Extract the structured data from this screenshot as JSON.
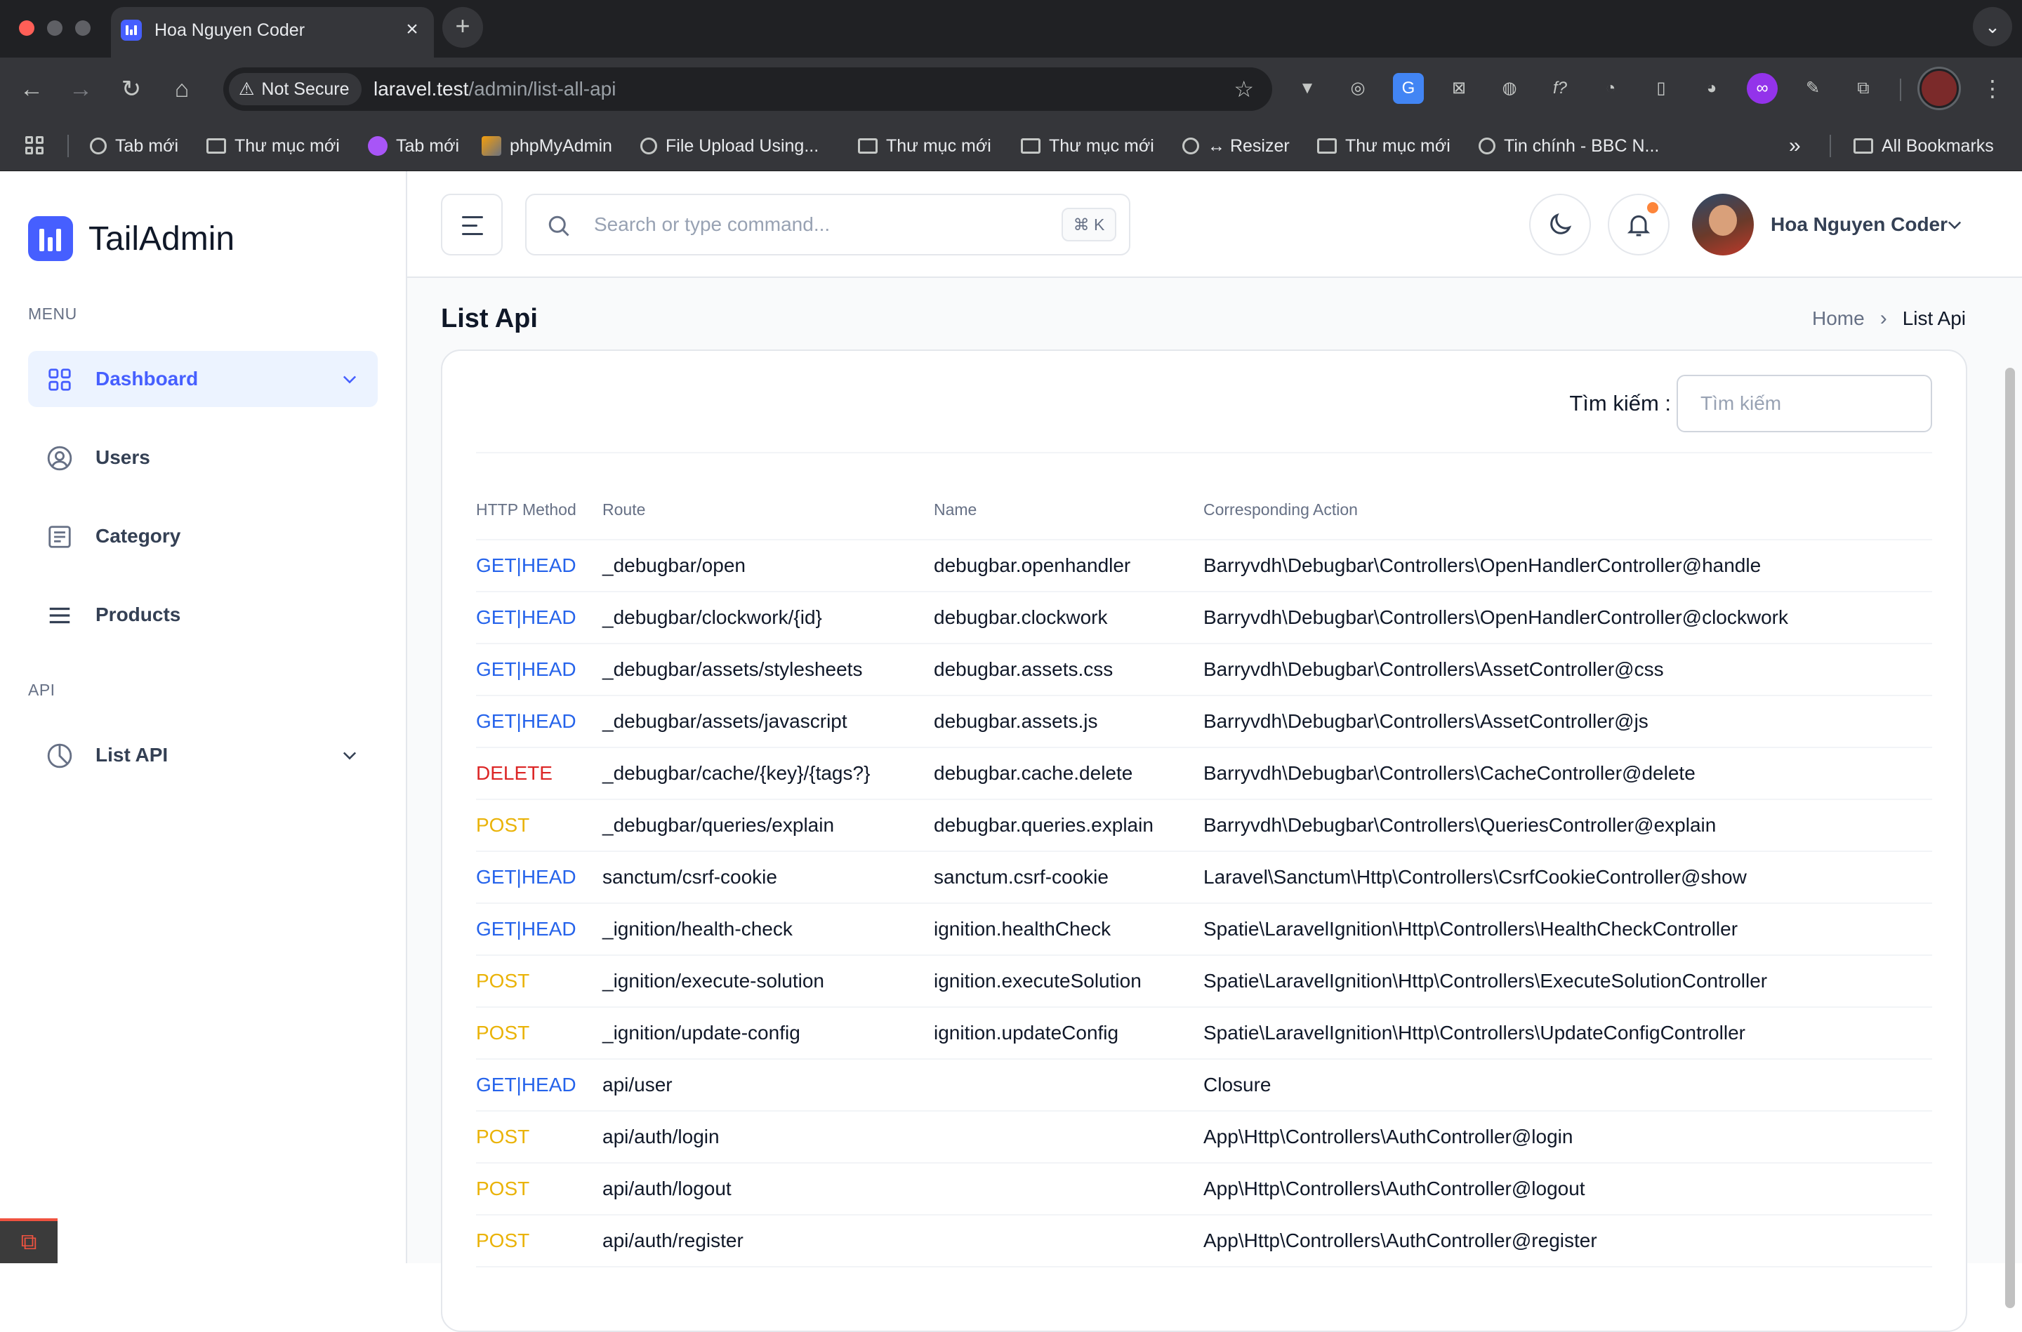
{
  "browser": {
    "tab_title": "Hoa Nguyen Coder",
    "security_label": "Not Secure",
    "url_host": "laravel.test",
    "url_path": "/admin/list-all-api",
    "bookmarks": [
      {
        "label": "Tab mới",
        "icon": "globe"
      },
      {
        "label": "Thư mục mới",
        "icon": "folder"
      },
      {
        "label": "Tab mới",
        "icon": "purple-app"
      },
      {
        "label": "phpMyAdmin",
        "icon": "phpmyadmin"
      },
      {
        "label": "File Upload Using...",
        "icon": "globe"
      },
      {
        "label": "Thư mục mới",
        "icon": "folder"
      },
      {
        "label": "Thư mục mới",
        "icon": "folder"
      },
      {
        "label": "↔ Resizer",
        "icon": "globe"
      },
      {
        "label": "Thư mục mới",
        "icon": "folder"
      },
      {
        "label": "Tin chính - BBC N...",
        "icon": "globe"
      }
    ],
    "more_bookmarks": "»",
    "all_bookmarks": "All Bookmarks"
  },
  "sidebar": {
    "brand": "TailAdmin",
    "group_menu": "MENU",
    "group_api": "API",
    "items": [
      {
        "label": "Dashboard",
        "icon": "grid-icon",
        "active": true
      },
      {
        "label": "Users",
        "icon": "user-circle-icon"
      },
      {
        "label": "Category",
        "icon": "list-box-icon"
      },
      {
        "label": "Products",
        "icon": "menu-lines-icon"
      },
      {
        "label": "List API",
        "icon": "pie-chart-icon"
      }
    ]
  },
  "header": {
    "search_placeholder": "Search or type command...",
    "shortcut": "⌘ K",
    "user_name": "Hoa Nguyen Coder"
  },
  "page": {
    "title": "List Api",
    "breadcrumb_home": "Home",
    "breadcrumb_current": "List Api",
    "filter_label": "Tìm kiếm :",
    "filter_placeholder": "Tìm kiếm"
  },
  "table": {
    "columns": [
      "HTTP Method",
      "Route",
      "Name",
      "Corresponding Action"
    ],
    "rows": [
      {
        "method": "GET|HEAD",
        "route": "_debugbar/open",
        "name": "debugbar.openhandler",
        "action": "Barryvdh\\Debugbar\\Controllers\\OpenHandlerController@handle"
      },
      {
        "method": "GET|HEAD",
        "route": "_debugbar/clockwork/{id}",
        "name": "debugbar.clockwork",
        "action": "Barryvdh\\Debugbar\\Controllers\\OpenHandlerController@clockwork"
      },
      {
        "method": "GET|HEAD",
        "route": "_debugbar/assets/stylesheets",
        "name": "debugbar.assets.css",
        "action": "Barryvdh\\Debugbar\\Controllers\\AssetController@css"
      },
      {
        "method": "GET|HEAD",
        "route": "_debugbar/assets/javascript",
        "name": "debugbar.assets.js",
        "action": "Barryvdh\\Debugbar\\Controllers\\AssetController@js"
      },
      {
        "method": "DELETE",
        "route": "_debugbar/cache/{key}/{tags?}",
        "name": "debugbar.cache.delete",
        "action": "Barryvdh\\Debugbar\\Controllers\\CacheController@delete"
      },
      {
        "method": "POST",
        "route": "_debugbar/queries/explain",
        "name": "debugbar.queries.explain",
        "action": "Barryvdh\\Debugbar\\Controllers\\QueriesController@explain"
      },
      {
        "method": "GET|HEAD",
        "route": "sanctum/csrf-cookie",
        "name": "sanctum.csrf-cookie",
        "action": "Laravel\\Sanctum\\Http\\Controllers\\CsrfCookieController@show"
      },
      {
        "method": "GET|HEAD",
        "route": "_ignition/health-check",
        "name": "ignition.healthCheck",
        "action": "Spatie\\LaravelIgnition\\Http\\Controllers\\HealthCheckController"
      },
      {
        "method": "POST",
        "route": "_ignition/execute-solution",
        "name": "ignition.executeSolution",
        "action": "Spatie\\LaravelIgnition\\Http\\Controllers\\ExecuteSolutionController"
      },
      {
        "method": "POST",
        "route": "_ignition/update-config",
        "name": "ignition.updateConfig",
        "action": "Spatie\\LaravelIgnition\\Http\\Controllers\\UpdateConfigController"
      },
      {
        "method": "GET|HEAD",
        "route": "api/user",
        "name": "",
        "action": "Closure"
      },
      {
        "method": "POST",
        "route": "api/auth/login",
        "name": "",
        "action": "App\\Http\\Controllers\\AuthController@login"
      },
      {
        "method": "POST",
        "route": "api/auth/logout",
        "name": "",
        "action": "App\\Http\\Controllers\\AuthController@logout"
      },
      {
        "method": "POST",
        "route": "api/auth/register",
        "name": "",
        "action": "App\\Http\\Controllers\\AuthController@register"
      }
    ]
  },
  "colors": {
    "brand": "#465fff",
    "method_get": "#2563eb",
    "method_post": "#eab308",
    "method_delete": "#dc2626"
  }
}
